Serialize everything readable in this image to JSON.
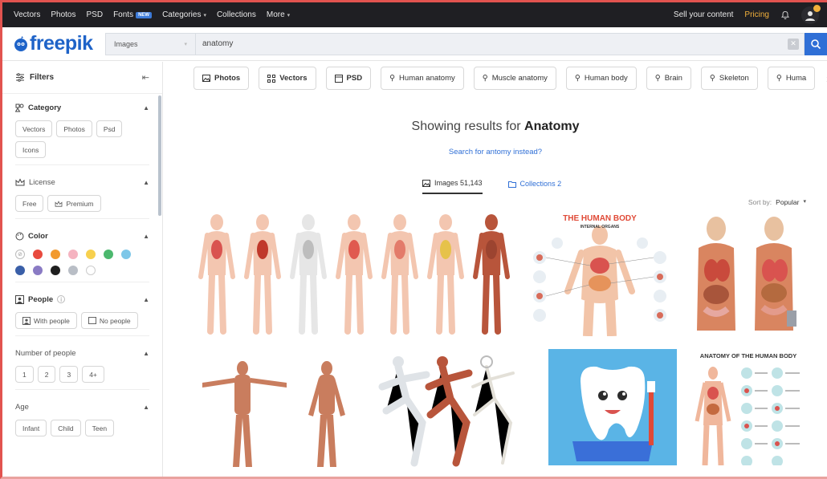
{
  "topnav": {
    "items": [
      "Vectors",
      "Photos",
      "PSD",
      "Fonts",
      "Categories",
      "Collections",
      "More"
    ],
    "fonts_badge": "NEW",
    "sell": "Sell your content",
    "pricing": "Pricing"
  },
  "search": {
    "logo": "freepik",
    "type": "Images",
    "query": "anatomy"
  },
  "sidebar": {
    "title": "Filters",
    "category": {
      "title": "Category",
      "chips": [
        "Vectors",
        "Photos",
        "Psd",
        "Icons"
      ]
    },
    "license": {
      "title": "License",
      "chips": [
        "Free",
        "Premium"
      ]
    },
    "color": {
      "title": "Color",
      "swatches": [
        "#e84a3e",
        "#f29a2e",
        "#f5b3c0",
        "#f7d04e",
        "#4cb86e",
        "#7ec7e8",
        "#3a5fa8",
        "#8a7bc4",
        "#1f1f1f",
        "#b9bec6",
        "#ffffff"
      ]
    },
    "people": {
      "title": "People",
      "chips": [
        "With people",
        "No people"
      ]
    },
    "number_of_people": {
      "title": "Number of people",
      "chips": [
        "1",
        "2",
        "3",
        "4+"
      ]
    },
    "age": {
      "title": "Age",
      "chips": [
        "Infant",
        "Child",
        "Teen"
      ]
    }
  },
  "tags": [
    "Photos",
    "Vectors",
    "PSD",
    "Human anatomy",
    "Muscle anatomy",
    "Human body",
    "Brain",
    "Skeleton",
    "Huma"
  ],
  "results": {
    "showing_prefix": "Showing results for",
    "term": "Anatomy",
    "suggest": "Search for antomy instead?",
    "tab_images": "Images 51,143",
    "tab_collections": "Collections 2",
    "sort_label": "Sort by:",
    "sort_value": "Popular"
  },
  "thumbs": {
    "body_chart_title": "THE HUMAN BODY",
    "body_chart_subtitle": "INTERNAL ORGANS",
    "anatomy_title": "ANATOMY OF THE HUMAN BODY"
  },
  "colors": {
    "accent": "#2f6fd6",
    "pricing": "#f1b03b",
    "nav_bg": "#1f1f23"
  }
}
